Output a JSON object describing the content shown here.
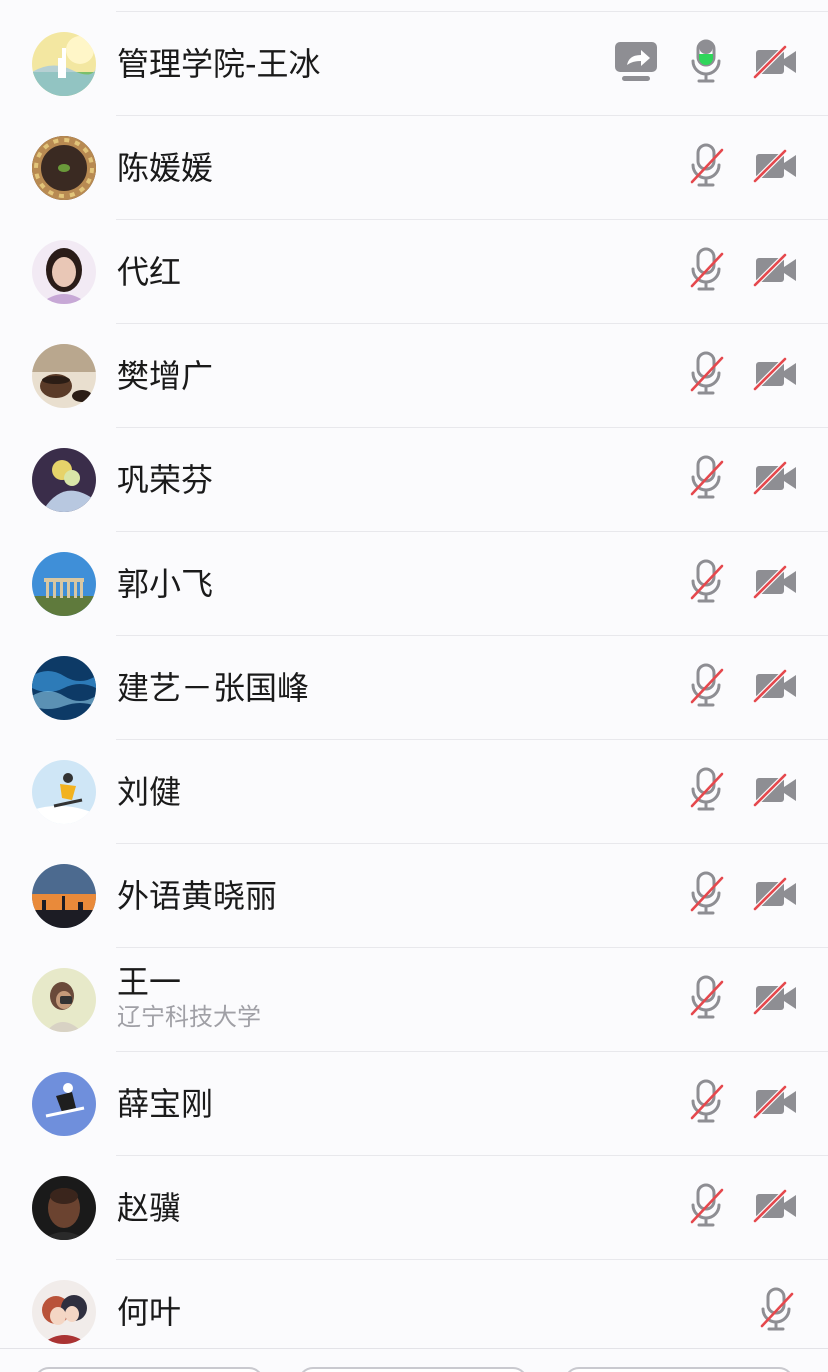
{
  "participants": [
    {
      "name": "管理学院-王冰",
      "subtitle": "",
      "sharing": true,
      "mic_active": true,
      "avatar": "llama-landscape",
      "avatar_colors": [
        "#f3e7a1",
        "#9bc6e8",
        "#7cbf6a"
      ]
    },
    {
      "name": "陈媛媛",
      "subtitle": "",
      "sharing": false,
      "mic_active": false,
      "avatar": "food-wreath",
      "avatar_colors": [
        "#3a2a22",
        "#b88a52",
        "#e2c57a"
      ]
    },
    {
      "name": "代红",
      "subtitle": "",
      "sharing": false,
      "mic_active": false,
      "avatar": "portrait-woman",
      "avatar_colors": [
        "#f2eaf4",
        "#2a1c18",
        "#e9c7b6"
      ]
    },
    {
      "name": "樊增广",
      "subtitle": "",
      "sharing": false,
      "mic_active": false,
      "avatar": "tea-cup",
      "avatar_colors": [
        "#e9dfcf",
        "#5a3b28",
        "#2b1d15"
      ]
    },
    {
      "name": "巩荣芬",
      "subtitle": "",
      "sharing": false,
      "mic_active": false,
      "avatar": "flower-painting",
      "avatar_colors": [
        "#3a2d4a",
        "#b8c8e0",
        "#e6d36a"
      ]
    },
    {
      "name": "郭小飞",
      "subtitle": "",
      "sharing": false,
      "mic_active": false,
      "avatar": "temple-ruins",
      "avatar_colors": [
        "#3f8fd8",
        "#d8c7a2",
        "#5f7a3c"
      ]
    },
    {
      "name": "建艺－张国峰",
      "subtitle": "",
      "sharing": false,
      "mic_active": false,
      "avatar": "water-waves",
      "avatar_colors": [
        "#0d3a66",
        "#2d7bb8",
        "#8fcbe8"
      ]
    },
    {
      "name": "刘健",
      "subtitle": "",
      "sharing": false,
      "mic_active": false,
      "avatar": "snowboarder",
      "avatar_colors": [
        "#cfe6f6",
        "#f2b21f",
        "#ffffff"
      ]
    },
    {
      "name": "外语黄晓丽",
      "subtitle": "",
      "sharing": false,
      "mic_active": false,
      "avatar": "sunset-city",
      "avatar_colors": [
        "#4c6a8f",
        "#e98a3a",
        "#1c1c24"
      ]
    },
    {
      "name": "王一",
      "subtitle": "辽宁科技大学",
      "sharing": false,
      "mic_active": false,
      "avatar": "photographer-girl",
      "avatar_colors": [
        "#e7e9c9",
        "#c49a7a",
        "#6a4a3a"
      ]
    },
    {
      "name": "薛宝刚",
      "subtitle": "",
      "sharing": false,
      "mic_active": false,
      "avatar": "skier-blue",
      "avatar_colors": [
        "#6f8fdc",
        "#1e1e1e",
        "#ffffff"
      ]
    },
    {
      "name": "赵骥",
      "subtitle": "",
      "sharing": false,
      "mic_active": false,
      "avatar": "portrait-dark",
      "avatar_colors": [
        "#1a1a1a",
        "#6b4330",
        "#3a251c"
      ]
    },
    {
      "name": "何叶",
      "subtitle": "",
      "sharing": false,
      "mic_active": false,
      "no_camera": true,
      "avatar": "anime-couple",
      "avatar_colors": [
        "#f1ecea",
        "#b9533a",
        "#2f2f3f"
      ]
    }
  ],
  "icons": {
    "mic_color": "#8e8e93",
    "mic_active_color": "#2fd65a",
    "muted_slash_color": "#e5484d",
    "share_color": "#8e8e93"
  }
}
